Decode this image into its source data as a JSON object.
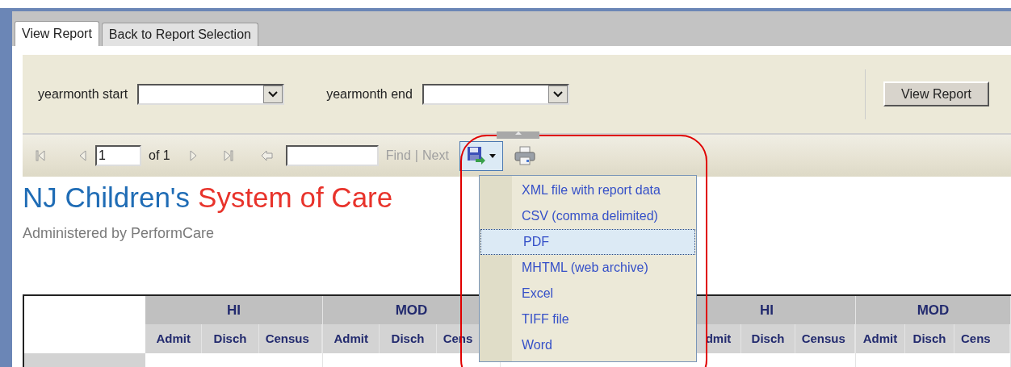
{
  "tabs": [
    {
      "label": "View Report",
      "selected": true
    },
    {
      "label": "Back to Report Selection",
      "selected": false
    }
  ],
  "parameters": [
    {
      "label": "yearmonth start"
    },
    {
      "label": "yearmonth end"
    }
  ],
  "view_button": "View Report",
  "toolbar": {
    "page": "1",
    "page_count": "of 1",
    "find_label": "Find",
    "separator": "|",
    "next_label": "Next",
    "find_enabled": false,
    "export_expanded": true
  },
  "export_menu": [
    {
      "label": "XML file with report data",
      "selected": false
    },
    {
      "label": "CSV (comma delimited)",
      "selected": false
    },
    {
      "label": "PDF",
      "selected": true
    },
    {
      "label": "MHTML (web archive)",
      "selected": false
    },
    {
      "label": "Excel",
      "selected": false
    },
    {
      "label": "TIFF file",
      "selected": false
    },
    {
      "label": "Word",
      "selected": false
    }
  ],
  "report": {
    "title": "NJ Children's",
    "title_accent": "System of Care",
    "subtitle": "Administered by PerformCare"
  },
  "table": {
    "groups": [
      {
        "kind": "group",
        "label": "HI",
        "columns": [
          "Admit",
          "Disch",
          "Census"
        ]
      },
      {
        "kind": "group",
        "label": "MOD",
        "columns": [
          "Admit",
          "Disch",
          "Cens"
        ]
      },
      {
        "kind": "covered"
      },
      {
        "kind": "clipped",
        "label": "HI",
        "columns": [
          "dmit",
          "Disch",
          "Census"
        ]
      },
      {
        "kind": "group",
        "label": "MOD",
        "columns": [
          "Admit",
          "Disch",
          "Cens"
        ]
      }
    ]
  }
}
